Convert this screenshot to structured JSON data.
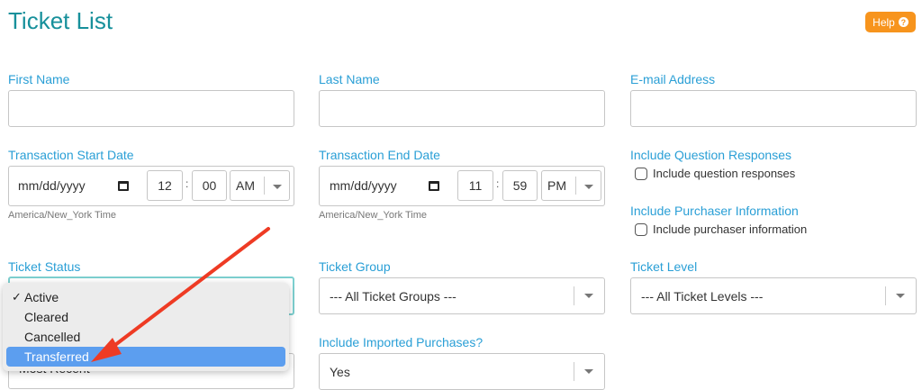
{
  "page": {
    "title": "Ticket List",
    "help_label": "Help"
  },
  "fields": {
    "first_name": {
      "label": "First Name",
      "value": ""
    },
    "last_name": {
      "label": "Last Name",
      "value": ""
    },
    "email": {
      "label": "E-mail Address",
      "value": ""
    },
    "transaction_start": {
      "label": "Transaction Start Date",
      "date_placeholder": "mm/dd/yyyy",
      "hour": "12",
      "minute": "00",
      "ampm": "AM",
      "timezone": "America/New_York Time"
    },
    "transaction_end": {
      "label": "Transaction End Date",
      "date_placeholder": "mm/dd/yyyy",
      "hour": "11",
      "minute": "59",
      "ampm": "PM",
      "timezone": "America/New_York Time"
    },
    "question_responses": {
      "label": "Include Question Responses",
      "checkbox_label": "Include question responses",
      "checked": false
    },
    "purchaser_info": {
      "label": "Include Purchaser Information",
      "checkbox_label": "Include purchaser information",
      "checked": false
    },
    "ticket_status": {
      "label": "Ticket Status",
      "options": [
        "Active",
        "Cleared",
        "Cancelled",
        "Transferred"
      ],
      "checked_option": "Active",
      "highlighted_option": "Transferred"
    },
    "ticket_group": {
      "label": "Ticket Group",
      "value": "--- All Ticket Groups ---"
    },
    "ticket_level": {
      "label": "Ticket Level",
      "value": "--- All Ticket Levels ---"
    },
    "sort_select": {
      "value": "Most Recent"
    },
    "imported_purchases": {
      "label": "Include Imported Purchases?",
      "value": "Yes"
    }
  },
  "colors": {
    "title": "#17909b",
    "label": "#2a9fd6",
    "help_button": "#f7941d",
    "highlight": "#5c9eef",
    "arrow": "#ee3b24"
  },
  "icons": {
    "help": "question-circle-icon",
    "calendar": "calendar-icon",
    "dropdown": "chevron-down-icon",
    "annotation": "red-arrow"
  }
}
